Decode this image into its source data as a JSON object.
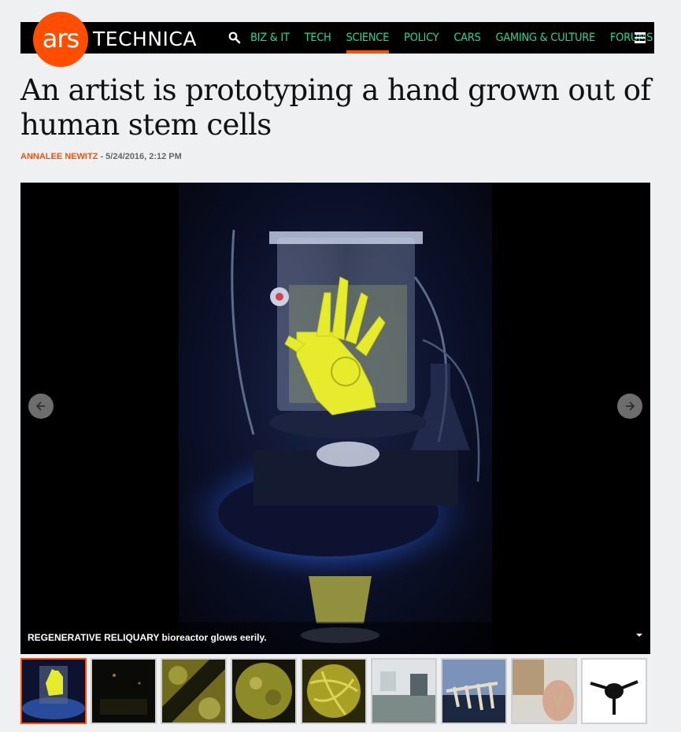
{
  "brand": {
    "logo_ars": "ars",
    "logo_technica": "TECHNICA",
    "accent": "#ff4e00",
    "nav_green": "#29d29c"
  },
  "nav": {
    "search_icon": "search-icon",
    "items": [
      {
        "label": "BIZ & IT",
        "active": false
      },
      {
        "label": "TECH",
        "active": false
      },
      {
        "label": "SCIENCE",
        "active": true
      },
      {
        "label": "POLICY",
        "active": false
      },
      {
        "label": "CARS",
        "active": false
      },
      {
        "label": "GAMING & CULTURE",
        "active": false
      },
      {
        "label": "FORUMS",
        "active": false
      }
    ],
    "menu_icon": "hamburger-menu-icon"
  },
  "article": {
    "headline": "An artist is prototyping a hand grown out of human stem cells",
    "author": "ANNALEE NEWITZ",
    "separator": " - ",
    "date": "5/24/2016, 2:12 PM"
  },
  "gallery": {
    "caption_bold": "REGENERATIVE RELIQUARY",
    "caption_rest": " bioreactor glows eerily.",
    "prev_icon": "arrow-left-icon",
    "next_icon": "arrow-right-icon",
    "toggle_icon": "caret-down-icon",
    "thumbnails": [
      {
        "subject": "glowing hand bioreactor",
        "active": true
      },
      {
        "subject": "dark lab",
        "active": false
      },
      {
        "subject": "cells micrograph diagonal",
        "active": false
      },
      {
        "subject": "cells micrograph round",
        "active": false
      },
      {
        "subject": "cells micrograph fibers",
        "active": false
      },
      {
        "subject": "lab workspace",
        "active": false
      },
      {
        "subject": "skeleton hand model",
        "active": false
      },
      {
        "subject": "printed hand in palm",
        "active": false
      },
      {
        "subject": "black printed object",
        "active": false
      }
    ]
  }
}
